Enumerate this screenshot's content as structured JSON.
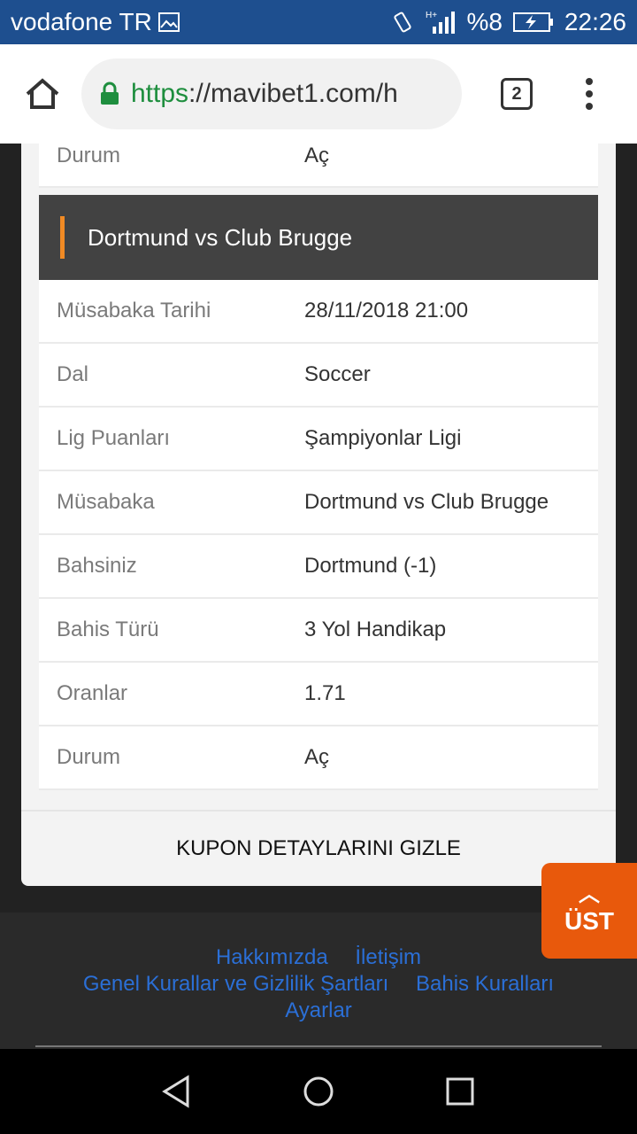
{
  "status_bar": {
    "carrier": "vodafone TR",
    "battery": "%8",
    "time": "22:26"
  },
  "browser": {
    "url_scheme": "https",
    "url_rest": "://mavibet1.com/h",
    "tab_count": "2"
  },
  "prev_row": {
    "label": "Durum",
    "value": "Aç"
  },
  "match": {
    "title": "Dortmund vs Club Brugge",
    "rows": [
      {
        "label": "Müsabaka Tarihi",
        "value": "28/11/2018 21:00"
      },
      {
        "label": "Dal",
        "value": "Soccer"
      },
      {
        "label": "Lig Puanları",
        "value": "Şampiyonlar Ligi"
      },
      {
        "label": "Müsabaka",
        "value": "Dortmund vs Club Brugge"
      },
      {
        "label": "Bahsiniz",
        "value": "Dortmund (-1)"
      },
      {
        "label": "Bahis Türü",
        "value": "3 Yol Handikap"
      },
      {
        "label": "Oranlar",
        "value": "1.71"
      },
      {
        "label": "Durum",
        "value": "Aç"
      }
    ]
  },
  "hide_details_label": "KUPON DETAYLARINI GIZLE",
  "scroll_top_label": "ÜST",
  "footer": {
    "about": "Hakkımızda",
    "contact": "İletişim",
    "terms": "Genel Kurallar ve Gizlilik Şartları",
    "bet_rules": "Bahis Kuralları",
    "settings": "Ayarlar"
  },
  "colors": {
    "status_bar": "#1e4f8f",
    "accent": "#f08a24",
    "scroll_button": "#e8590c",
    "link": "#2b6fd6"
  }
}
